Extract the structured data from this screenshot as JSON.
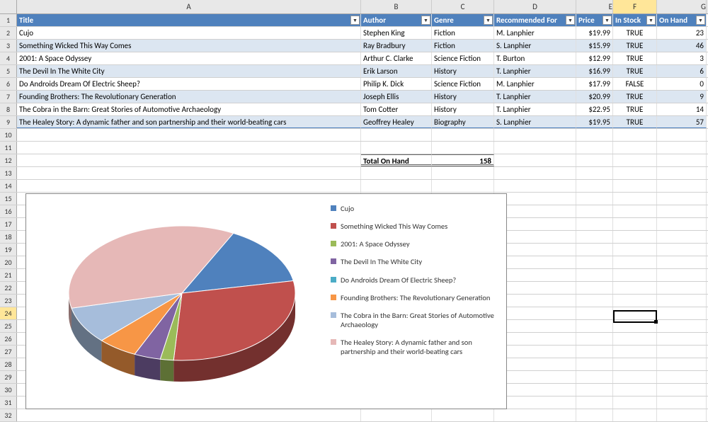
{
  "columns": [
    "A",
    "B",
    "C",
    "D",
    "E",
    "F",
    "G"
  ],
  "headers": {
    "A": "Title",
    "B": "Author",
    "C": "Genre",
    "D": "Recommended For",
    "E": "Price",
    "F": "In Stock",
    "G": "On Hand"
  },
  "rows": [
    {
      "title": "Cujo",
      "author": "Stephen King",
      "genre": "Fiction",
      "rec": "M. Lanphier",
      "price": "$19.99",
      "stock": "TRUE",
      "onhand": "23"
    },
    {
      "title": "Something Wicked This Way Comes",
      "author": "Ray Bradbury",
      "genre": "Fiction",
      "rec": "S. Lanphier",
      "price": "$15.99",
      "stock": "TRUE",
      "onhand": "46"
    },
    {
      "title": "2001: A Space Odyssey",
      "author": "Arthur C. Clarke",
      "genre": "Science Fiction",
      "rec": "T. Burton",
      "price": "$12.99",
      "stock": "TRUE",
      "onhand": "3"
    },
    {
      "title": "The Devil In The White City",
      "author": "Erik Larson",
      "genre": "History",
      "rec": "T. Lanphier",
      "price": "$16.99",
      "stock": "TRUE",
      "onhand": "6"
    },
    {
      "title": "Do Androids Dream Of Electric Sheep?",
      "author": "Philip K. Dick",
      "genre": "Science Fiction",
      "rec": "M. Lanphier",
      "price": "$17.99",
      "stock": "FALSE",
      "onhand": "0"
    },
    {
      "title": "Founding Brothers: The Revolutionary Generation",
      "author": "Joseph Ellis",
      "genre": "History",
      "rec": "T. Lanphier",
      "price": "$20.99",
      "stock": "TRUE",
      "onhand": "9"
    },
    {
      "title": "The Cobra in the Barn: Great Stories of Automotive Archaeology",
      "author": "Tom Cotter",
      "genre": "History",
      "rec": "T. Lanphier",
      "price": "$22.95",
      "stock": "TRUE",
      "onhand": "14"
    },
    {
      "title": "The Healey Story: A dynamic father and son partnership and their world-beating cars",
      "author": "Geoffrey Healey",
      "genre": "Biography",
      "rec": "S. Lanphier",
      "price": "$19.95",
      "stock": "TRUE",
      "onhand": "57"
    }
  ],
  "total_label": "Total On Hand",
  "total_value": "158",
  "selected_cell": "F24",
  "chart_data": {
    "type": "pie",
    "title": "",
    "series": [
      {
        "name": "Cujo",
        "value": 23,
        "color": "#4f81bd"
      },
      {
        "name": "Something Wicked This Way Comes",
        "value": 46,
        "color": "#c0504d"
      },
      {
        "name": "2001: A Space Odyssey",
        "value": 3,
        "color": "#9bbb59"
      },
      {
        "name": "The Devil In The White City",
        "value": 6,
        "color": "#8064a2"
      },
      {
        "name": "Do Androids Dream Of Electric Sheep?",
        "value": 0,
        "color": "#4bacc6"
      },
      {
        "name": "Founding Brothers: The Revolutionary Generation",
        "value": 9,
        "color": "#f79646"
      },
      {
        "name": "The Cobra in the Barn: Great Stories of Automotive Archaeology",
        "value": 14,
        "color": "#a6bddb"
      },
      {
        "name": "The Healey Story: A dynamic father and son partnership and their world-beating cars",
        "value": 57,
        "color": "#e6b8b7"
      }
    ]
  }
}
